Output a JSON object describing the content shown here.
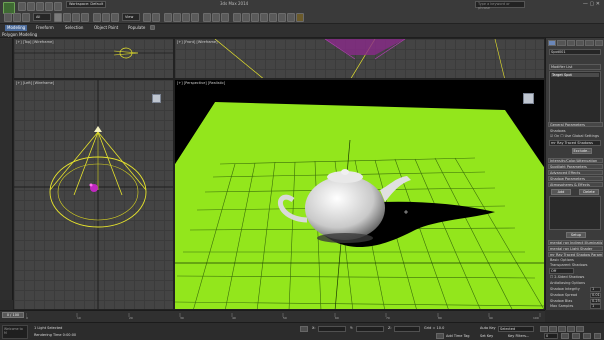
{
  "app": {
    "title": "3ds Max 2014",
    "workspace": "Workspace: Default",
    "search_placeholder": "Type a keyword or phrase"
  },
  "toolbar": {
    "undo_icon": "undo-icon",
    "selection_filter": "All",
    "view_dropdown": "View",
    "accent_color": "#4a6a9a"
  },
  "ribbon": {
    "tabs": [
      "Modeling",
      "Freeform",
      "Selection",
      "Object Paint",
      "Populate"
    ],
    "active_tab": "Modeling",
    "sub_label": "Polygon Modeling"
  },
  "viewports": {
    "top": "[+] [Top] [Wireframe]",
    "front": "[+] [Front] [Wireframe]",
    "left": "[+] [Left] [Wireframe]",
    "persp": "[+] [Perspective] [Realistic]"
  },
  "command_panel": {
    "object_name": "Spot001",
    "modifier_list": "Modifier List",
    "stack_item": "Target Spot",
    "rollouts": {
      "general": "General Parameters",
      "shadows_label": "Shadows",
      "shadows_on": "On",
      "use_global": "Use Global Settings",
      "shadow_type": "mr Ray Traced Shadows",
      "exclude": "Exclude...",
      "intensity": "Intensity/Color/Attenuation",
      "spotlight": "Spotlight Parameters",
      "advanced": "Advanced Effects",
      "shadow_params": "Shadow Parameters",
      "atmos": "Atmospheres & Effects",
      "add": "Add",
      "delete": "Delete",
      "setup": "Setup",
      "mr_indirect": "mental ray Indirect Illumination",
      "mr_shader": "mental ray Light Shader",
      "mr_rt_params": "mr Ray Traced Shadow Params",
      "basic_options": "Basic Options",
      "transp_shadows": "Transparent Shadows",
      "transp_value": "Off",
      "two_sided": "2-Sided Shadows",
      "antialias": "Antialiasing Options",
      "shadow_integrity_label": "Shadow Integrity",
      "shadow_integrity": "1",
      "shadow_spread_label": "Shadow Spread",
      "shadow_spread": "0.01",
      "shadow_blur_label": "Shadow Bias",
      "shadow_blur": "0.25",
      "samples_label": "Max Samples",
      "samples": "1"
    }
  },
  "timeline": {
    "slider": "0 / 100",
    "ticks": [
      "0",
      "10",
      "20",
      "30",
      "40",
      "50",
      "60",
      "70",
      "80",
      "90",
      "100"
    ]
  },
  "status": {
    "maxscript": "Welcome to M",
    "selected": "1 Light Selected",
    "rendering_time": "Rendering Time 0:00:00",
    "x_label": "X:",
    "y_label": "Y:",
    "z_label": "Z:",
    "grid": "Grid = 10.0",
    "auto_key": "Auto Key",
    "selected_dd": "Selected",
    "set_key": "Set Key",
    "key_filters": "Key Filters...",
    "add_time_tag": "Add Time Tag",
    "frame": "0"
  }
}
